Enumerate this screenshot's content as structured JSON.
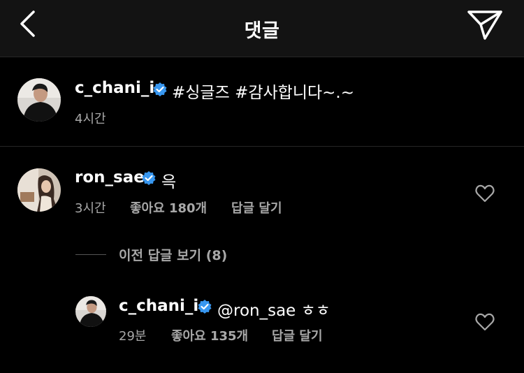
{
  "header": {
    "title": "댓글",
    "back_icon": "chevron-left-icon",
    "send_icon": "paper-plane-icon"
  },
  "caption": {
    "username": "c_chani_i",
    "text": "#싱글즈 #감사합니다~.~",
    "time": "4시간"
  },
  "comment": {
    "username": "ron_sae",
    "text": "윽",
    "time": "3시간",
    "likes": "좋아요 180개",
    "reply_label": "답글 달기"
  },
  "view_replies": "이전 답글 보기 (8)",
  "reply": {
    "username": "c_chani_i",
    "text": "@ron_sae ㅎㅎ",
    "time": "29분",
    "likes": "좋아요 135개",
    "reply_label": "답글 달기"
  },
  "colors": {
    "background": "#000000",
    "header_bg": "#131313",
    "verified": "#3897f0",
    "secondary_text": "#a8a8a8"
  }
}
